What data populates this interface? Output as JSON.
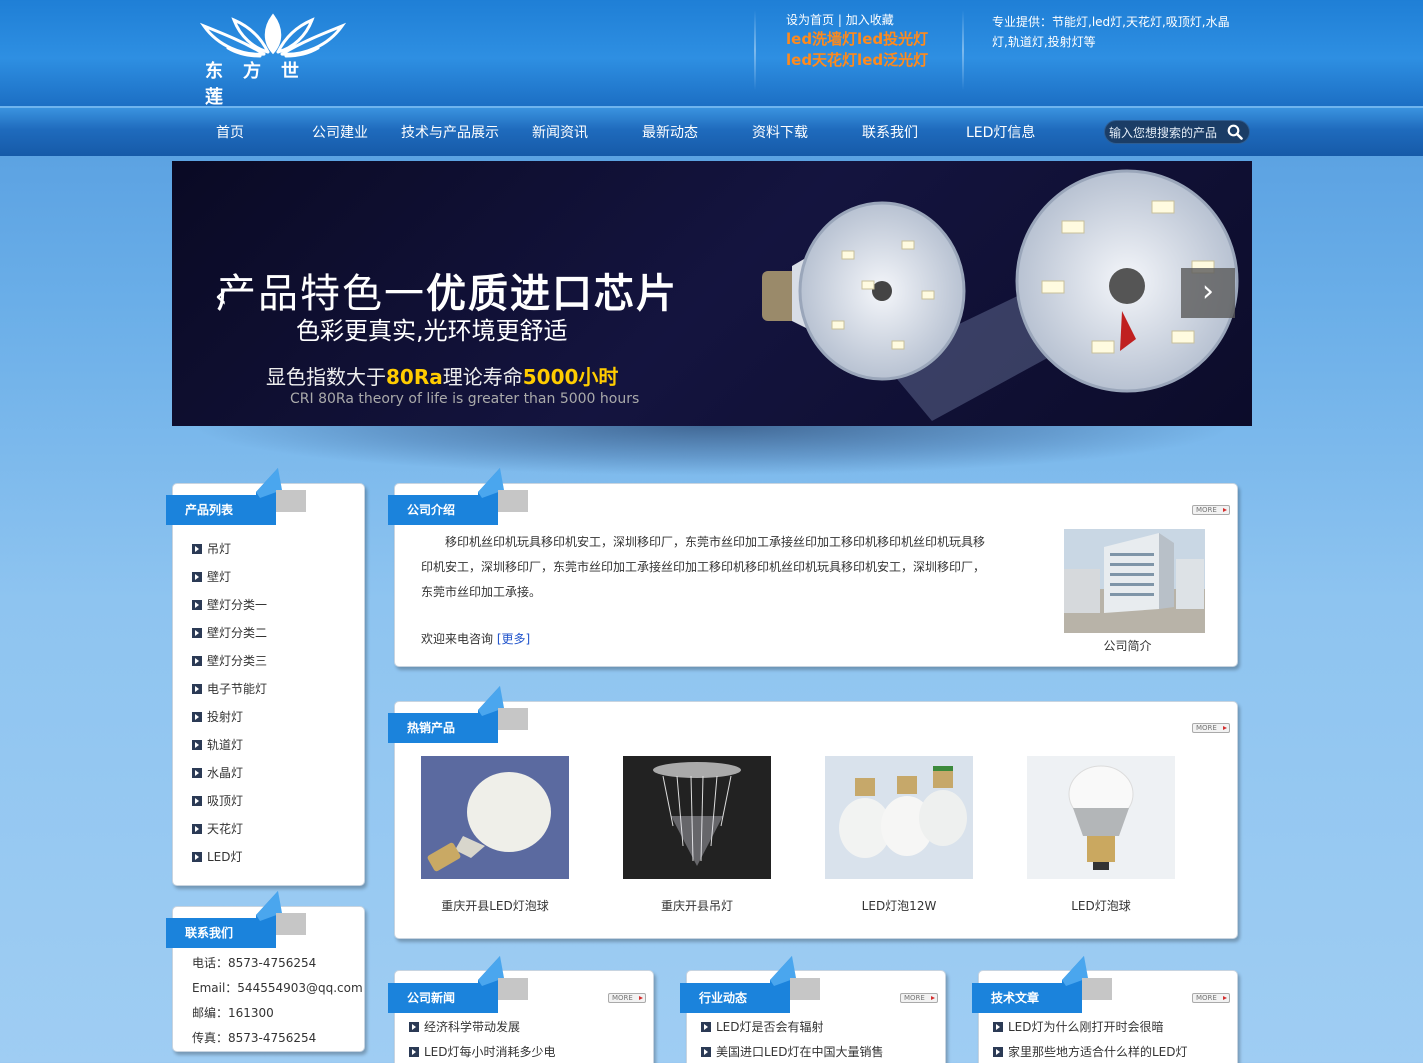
{
  "header": {
    "logo_text": "东方世莲",
    "links": [
      "设为首页",
      "加入收藏"
    ],
    "link_separator": "|",
    "highlight_lines": [
      "led洗墙灯led投光灯",
      "led天花灯led泛光灯"
    ],
    "provide_text": "专业提供：节能灯,led灯,天花灯,吸顶灯,水晶灯,轨道灯,投射灯等"
  },
  "nav": {
    "items": [
      "首页",
      "公司建业",
      "技术与产品展示",
      "新闻资讯",
      "最新动态",
      "资料下载",
      "联系我们",
      "LED灯信息"
    ],
    "search_placeholder": "输入您想搜索的产品"
  },
  "banner": {
    "title_a": "产品特色一",
    "title_b": "优质进口芯片",
    "subtitle": "色彩更真实,光环境更舒适",
    "line3_a": "显色指数大于",
    "line3_b": "80Ra",
    "line3_c": "理论寿命",
    "line3_d": "5000小时",
    "english": "CRI 80Ra theory of life is greater than 5000 hours",
    "prev_icon": "‹",
    "next_icon": "›"
  },
  "sidebar": {
    "product_title": "产品列表",
    "products": [
      "吊灯",
      "壁灯",
      "壁灯分类一",
      "壁灯分类二",
      "壁灯分类三",
      "电子节能灯",
      "投射灯",
      "轨道灯",
      "水晶灯",
      "吸顶灯",
      "天花灯",
      "LED灯"
    ],
    "contact_title": "联系我们",
    "contact": [
      "电话：8573-4756254",
      "Email：544554903@qq.com",
      "邮编：161300",
      "传真：8573-4756254"
    ]
  },
  "intro": {
    "title": "公司介绍",
    "more": "MORE",
    "text": "移印机丝印机玩具移印机安工，深圳移印厂，东莞市丝印加工承接丝印加工移印机移印机丝印机玩具移印机安工，深圳移印厂，东莞市丝印加工承接丝印加工移印机移印机丝印机玩具移印机安工，深圳移印厂，东莞市丝印加工承接。",
    "welcome": "欢迎来电咨询",
    "more_link": "[更多]",
    "image_caption": "公司简介"
  },
  "hot": {
    "title": "热销产品",
    "more": "MORE",
    "products": [
      "重庆开县LED灯泡球",
      "重庆开县吊灯",
      "LED灯泡12W",
      "LED灯泡球"
    ]
  },
  "news": {
    "title": "公司新闻",
    "more": "MORE",
    "items": [
      "经济科学带动发展",
      "LED灯每小时消耗多少电"
    ]
  },
  "industry": {
    "title": "行业动态",
    "more": "MORE",
    "items": [
      "LED灯是否会有辐射",
      "美国进口LED灯在中国大量销售"
    ]
  },
  "tech": {
    "title": "技术文章",
    "more": "MORE",
    "items": [
      "LED灯为什么刚打开时会很暗",
      "家里那些地方适合什么样的LED灯"
    ]
  },
  "colors": {
    "header_blue": "#1f7fd6",
    "nav_blue": "#165aa8",
    "tab_blue": "#1b83dc",
    "highlight_orange": "#ff8a1c"
  }
}
